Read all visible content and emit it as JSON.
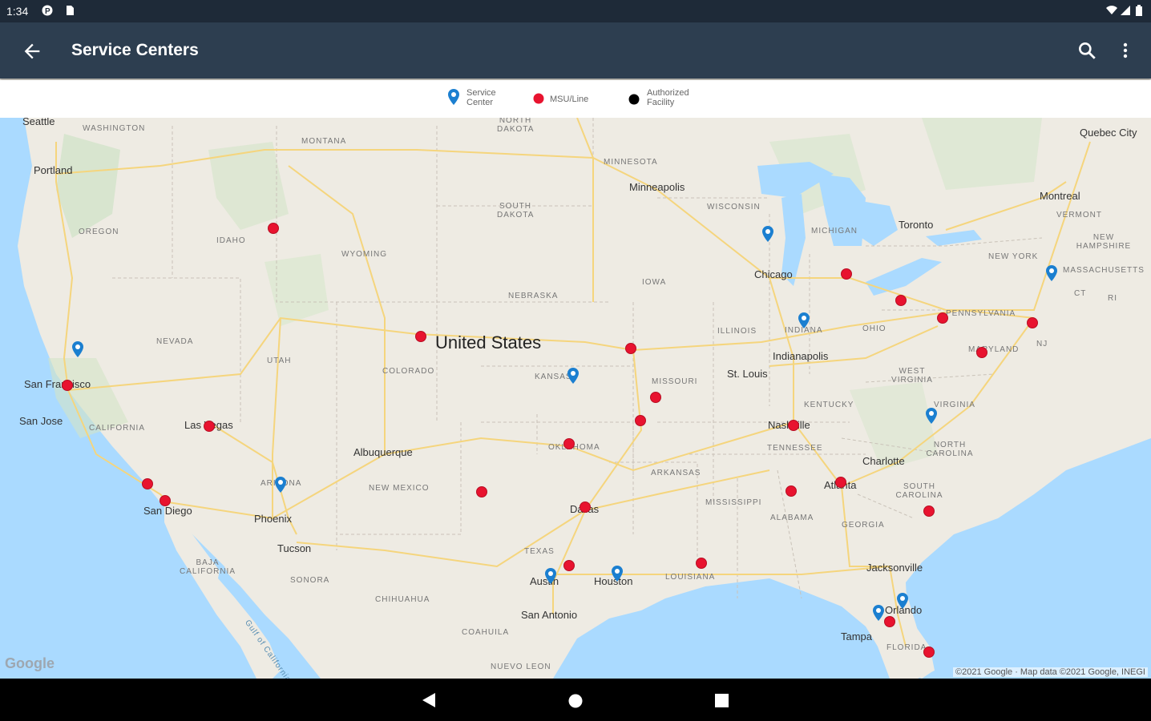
{
  "status_bar": {
    "time": "1:34"
  },
  "app_bar": {
    "title": "Service Centers"
  },
  "legend": [
    {
      "label": "Service Center",
      "icon": "blue-pin-icon"
    },
    {
      "label": "MSU/Line",
      "icon": "red-dot-icon"
    },
    {
      "label": "Authorized Facility",
      "icon": "black-dot-icon"
    }
  ],
  "map": {
    "country_label": "United States",
    "cities": [
      "Seattle",
      "Portland",
      "San Francisco",
      "San Jose",
      "Las Vegas",
      "San Diego",
      "Phoenix",
      "Tucson",
      "Albuquerque",
      "Minneapolis",
      "Chicago",
      "Indianapolis",
      "St. Louis",
      "Nashville",
      "Atlanta",
      "Charlotte",
      "Dallas",
      "Austin",
      "Houston",
      "San Antonio",
      "Jacksonville",
      "Orlando",
      "Tampa",
      "Toronto",
      "Montreal",
      "Quebec City"
    ],
    "states": [
      "WASHINGTON",
      "MONTANA",
      "NORTH DAKOTA",
      "MINNESOTA",
      "OREGON",
      "IDAHO",
      "SOUTH DAKOTA",
      "WISCONSIN",
      "MICHIGAN",
      "WYOMING",
      "NEBRASKA",
      "IOWA",
      "NEVADA",
      "UTAH",
      "COLORADO",
      "KANSAS",
      "MISSOURI",
      "ILLINOIS",
      "INDIANA",
      "OHIO",
      "PENNSYLVANIA",
      "NEW YORK",
      "VERMONT",
      "NEW HAMPSHIRE",
      "MASSACHUSETTS",
      "CT",
      "RI",
      "NJ",
      "MARYLAND",
      "WEST VIRGINIA",
      "VIRGINIA",
      "KENTUCKY",
      "TENNESSEE",
      "NORTH CAROLINA",
      "SOUTH CAROLINA",
      "CALIFORNIA",
      "ARIZONA",
      "NEW MEXICO",
      "OKLAHOMA",
      "ARKANSAS",
      "MISSISSIPPI",
      "ALABAMA",
      "GEORGIA",
      "TEXAS",
      "LOUISIANA",
      "FLORIDA",
      "BAJA CALIFORNIA",
      "SONORA",
      "CHIHUAHUA",
      "COAHUILA",
      "NUEVO LEON",
      "Gulf of California"
    ],
    "google_logo": "Google",
    "copyright": "©2021 Google · Map data ©2021 Google, INEGI"
  },
  "colors": {
    "status_bar": "#1e2a38",
    "app_bar": "#2d3e50",
    "red_marker": "#e8132f",
    "blue_pin": "#1b7fd0",
    "water": "#aadaff",
    "land": "#eeebe3",
    "highway": "#f6d56b"
  }
}
